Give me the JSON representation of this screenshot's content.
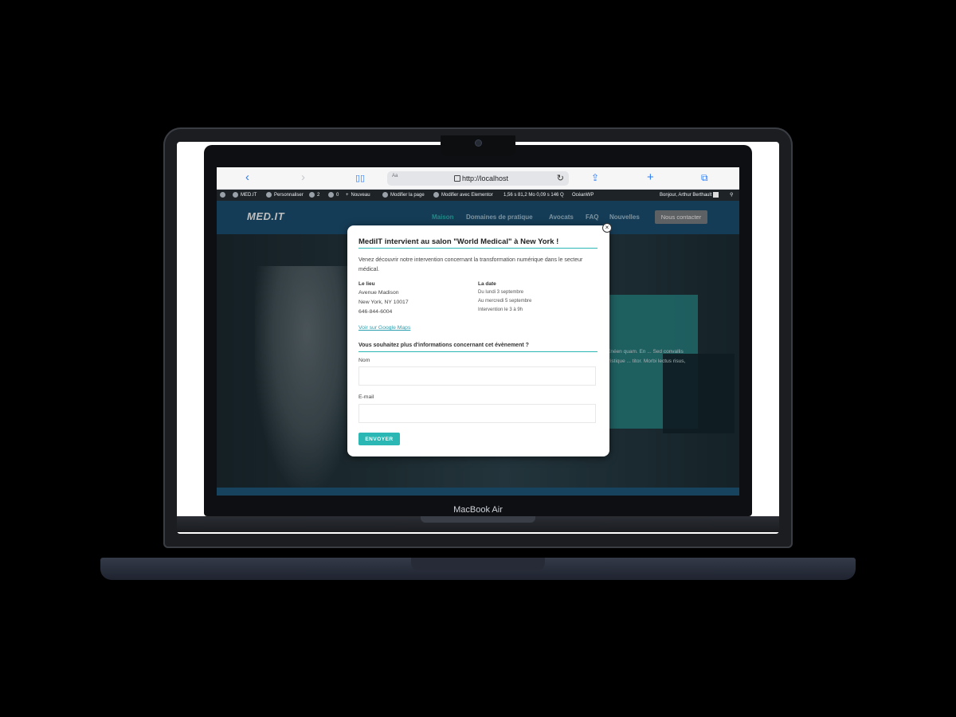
{
  "device": {
    "label": "MacBook Air"
  },
  "browser": {
    "url_aa": "Aa",
    "url": "http://localhost",
    "back_icon": "chevron-left-icon",
    "forward_icon": "chevron-right-icon",
    "reload_glyph": "↻",
    "add_glyph": "+"
  },
  "wp_admin": {
    "site": "MED.IT",
    "customize": "Personnaliser",
    "updates": "2",
    "comments": "0",
    "new": "Nouveau",
    "edit_page": "Modifier la page",
    "edit_elementor": "Modifier avec Elementor",
    "stats": "1,56 s  81,2 Mo   0,09 s  146 Q",
    "theme": "OcéanWP",
    "greeting": "Bonjour, Arthur Berthault"
  },
  "site": {
    "logo": "MED.IT",
    "menu": [
      "Maison",
      "Domaines de pratique",
      "Avocats",
      "FAQ",
      "Nouvelles"
    ],
    "contact": "Nous contacter",
    "hero_text": "Enéen quam. En ... Sed convallis tristique ... titor. Morbi lectus risus,"
  },
  "modal": {
    "close": "×",
    "title": "MediIT intervient au salon \"World Medical\" à New York !",
    "intro": "Venez découvrir notre intervention concernant la transformation numérique dans le secteur médical.",
    "place": {
      "heading": "Le lieu",
      "line1": "Avenue Madison",
      "line2": "New York, NY 10017",
      "phone": "646-844-6004",
      "link": "Voir sur Google Maps"
    },
    "date": {
      "heading": "La date",
      "line1": "Du lundi 3 septembre",
      "line2": "Au mercredi 5 septembre",
      "line3": "Intervention le 3 à 9h"
    },
    "form_title": "Vous souhaitez plus d'informations concernant cet évènement ?",
    "name_label": "Nom",
    "name_value": "",
    "email_label": "E-mail",
    "email_value": "",
    "submit": "ENVOYER"
  },
  "colors": {
    "accent": "#2bb7b3",
    "header": "#1c5173",
    "wp_bar": "#1d2327"
  }
}
